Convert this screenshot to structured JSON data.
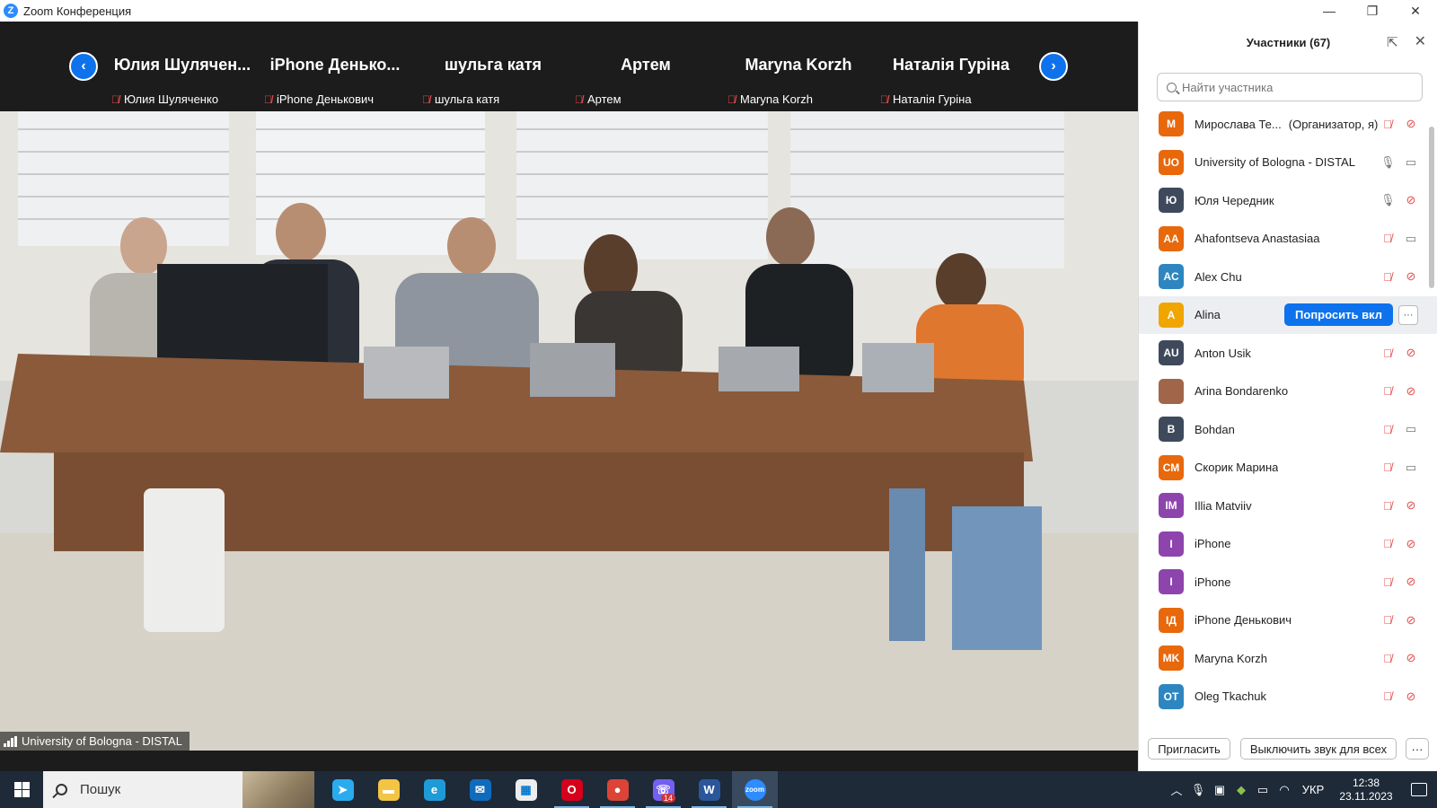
{
  "window": {
    "title": "Zoom Конференция",
    "app_icon": "Z",
    "controls": [
      "—",
      "❐",
      "✕"
    ]
  },
  "gallery": {
    "tiles": [
      {
        "name": "Юлия  Шулячен...",
        "label": "Юлия Шуляченко"
      },
      {
        "name": "iPhone  Денько...",
        "label": "iPhone Денькович"
      },
      {
        "name": "шульга катя",
        "label": "шульга катя"
      },
      {
        "name": "Артем",
        "label": "Артем"
      },
      {
        "name": "Maryna Korzh",
        "label": "Maryna Korzh"
      },
      {
        "name": "Наталія Гуріна",
        "label": "Наталія Гуріна"
      }
    ],
    "prev_icon": "chevron-left-icon",
    "next_icon": "chevron-right-icon"
  },
  "video": {
    "speaker": "University of Bologna - DISTAL"
  },
  "panel": {
    "title": "Участники (67)",
    "search_placeholder": "Найти участника",
    "participants": [
      {
        "initials": "М",
        "color": "#E8680C",
        "name": "Мирослава Те...",
        "role": "(Организатор, я)",
        "mic": "off",
        "video": "off"
      },
      {
        "initials": "UO",
        "color": "#E8680C",
        "name": "University of Bologna - DISTAL",
        "role": "",
        "mic": "on",
        "video": "on"
      },
      {
        "initials": "Ю",
        "color": "#3E4A5C",
        "name": "Юля Чередник",
        "role": "",
        "mic": "on",
        "video": "off"
      },
      {
        "initials": "AA",
        "color": "#E8680C",
        "name": "Ahafontseva Anastasiaa",
        "role": "",
        "mic": "off",
        "video": "on"
      },
      {
        "initials": "AC",
        "color": "#2E86C1",
        "name": "Alex Chu",
        "role": "",
        "mic": "off",
        "video": "off"
      },
      {
        "initials": "A",
        "color": "#F0A500",
        "name": "Alina",
        "role": "",
        "mic": "off",
        "video": "off",
        "ask_label": "Попросить вкл",
        "more": "···"
      },
      {
        "initials": "AU",
        "color": "#3E4A5C",
        "name": "Anton Usik",
        "role": "",
        "mic": "off",
        "video": "off"
      },
      {
        "initials": "",
        "color": "#A0664A",
        "name": "Arina Bondarenko",
        "role": "",
        "mic": "off",
        "video": "off"
      },
      {
        "initials": "B",
        "color": "#3E4A5C",
        "name": "Bohdan",
        "role": "",
        "mic": "off",
        "video": "on"
      },
      {
        "initials": "СМ",
        "color": "#E8680C",
        "name": "Скорик Марина",
        "role": "",
        "mic": "off",
        "video": "on"
      },
      {
        "initials": "IM",
        "color": "#8E44AD",
        "name": "Illia Matviiv",
        "role": "",
        "mic": "off",
        "video": "off"
      },
      {
        "initials": "I",
        "color": "#8E44AD",
        "name": "iPhone",
        "role": "",
        "mic": "off",
        "video": "off"
      },
      {
        "initials": "I",
        "color": "#8E44AD",
        "name": "iPhone",
        "role": "",
        "mic": "off",
        "video": "off"
      },
      {
        "initials": "ІД",
        "color": "#E8680C",
        "name": "iPhone Денькович",
        "role": "",
        "mic": "off",
        "video": "off"
      },
      {
        "initials": "MK",
        "color": "#E8680C",
        "name": "Maryna Korzh",
        "role": "",
        "mic": "off",
        "video": "off"
      },
      {
        "initials": "OT",
        "color": "#2E86C1",
        "name": "Oleg Tkachuk",
        "role": "",
        "mic": "off",
        "video": "off"
      }
    ],
    "footer": {
      "invite": "Пригласить",
      "mute_all": "Выключить звук для всех",
      "more": "···"
    }
  },
  "taskbar": {
    "search_text": "Пошук",
    "apps": [
      {
        "name": "telegram",
        "glyph": "➤",
        "color": "#2AABEE",
        "open": false
      },
      {
        "name": "file-explorer",
        "glyph": "▬",
        "color": "#F4C542",
        "open": false
      },
      {
        "name": "edge",
        "glyph": "e",
        "color": "#1E9BD7",
        "open": false
      },
      {
        "name": "mail",
        "glyph": "✉",
        "color": "#0F6CBD",
        "open": false
      },
      {
        "name": "store",
        "glyph": "▦",
        "color": "#EDEDED",
        "open": false
      },
      {
        "name": "opera",
        "glyph": "O",
        "color": "#D6001C",
        "open": true
      },
      {
        "name": "chrome",
        "glyph": "●",
        "color": "#DB4437",
        "open": true
      },
      {
        "name": "viber",
        "glyph": "☏",
        "color": "#7360F2",
        "open": true,
        "badge": "14"
      },
      {
        "name": "word",
        "glyph": "W",
        "color": "#2B579A",
        "open": true
      },
      {
        "name": "zoom",
        "glyph": "zoom",
        "color": "#2D8CFF",
        "open": true,
        "active": true
      }
    ],
    "tray": {
      "lang": "УКР",
      "time": "12:38",
      "date": "23.11.2023"
    }
  }
}
